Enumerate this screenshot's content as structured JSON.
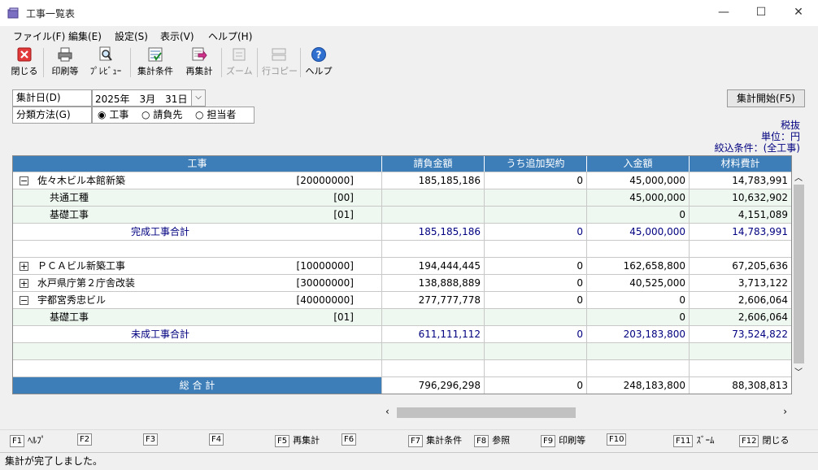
{
  "window": {
    "title": "工事一覧表",
    "minimize": "—",
    "maximize": "☐",
    "close": "✕"
  },
  "menu": [
    "ファイル(F)",
    "編集(E)",
    "設定(S)",
    "表示(V)",
    "ヘルプ(H)"
  ],
  "toolbar": [
    {
      "label": "閉じる",
      "icon": "close-icon"
    },
    {
      "label": "印刷等",
      "icon": "printer-icon"
    },
    {
      "label": "ﾌﾟﾚﾋﾞｭｰ",
      "icon": "preview-icon"
    },
    {
      "label": "集計条件",
      "icon": "conditions-icon"
    },
    {
      "label": "再集計",
      "icon": "recalc-icon"
    },
    {
      "label": "ズーム",
      "icon": "zoom-icon",
      "disabled": true
    },
    {
      "label": "行コピー",
      "icon": "row-copy-icon",
      "disabled": true
    },
    {
      "label": "ヘルプ",
      "icon": "help-icon"
    }
  ],
  "form": {
    "date_label": "集計日(D)",
    "date_value": "2025年　3月　31日",
    "class_label": "分類方法(G)",
    "options": [
      "工事",
      "請負先",
      "担当者"
    ],
    "selected": 0,
    "start_button": "集計開始(F5)"
  },
  "info": {
    "tax": "税抜",
    "unit": "単位：円",
    "filter": "絞込条件：(全工事)"
  },
  "columns": [
    "工事",
    "請負金額",
    "うち追加契約",
    "入金額",
    "材料費計"
  ],
  "rows": [
    {
      "expander": "−",
      "indent": 0,
      "name": "佐々木ビル本館新築",
      "code": "[20000000]",
      "amount": "185,185,186",
      "addition": "0",
      "received": "45,000,000",
      "material": "14,783,991"
    },
    {
      "indent": 1,
      "green": true,
      "name": "共通工種",
      "code": "[00]",
      "amount": "",
      "addition": "",
      "received": "45,000,000",
      "material": "10,632,902"
    },
    {
      "indent": 1,
      "green": true,
      "name": "基礎工事",
      "code": "[01]",
      "amount": "",
      "addition": "",
      "received": "0",
      "material": "4,151,089"
    },
    {
      "indent": 2,
      "total": true,
      "name": "完成工事合計",
      "code": "",
      "amount": "185,185,186",
      "addition": "0",
      "received": "45,000,000",
      "material": "14,783,991"
    },
    {
      "blank": true
    },
    {
      "expander": "+",
      "indent": 0,
      "name": "ＰＣＡビル新築工事",
      "code": "[10000000]",
      "amount": "194,444,445",
      "addition": "0",
      "received": "162,658,800",
      "material": "67,205,636"
    },
    {
      "expander": "+",
      "indent": 0,
      "name": "水戸県庁第２庁舎改装",
      "code": "[30000000]",
      "amount": "138,888,889",
      "addition": "0",
      "received": "40,525,000",
      "material": "3,713,122"
    },
    {
      "expander": "−",
      "indent": 0,
      "name": "宇都宮秀忠ビル",
      "code": "[40000000]",
      "amount": "277,777,778",
      "addition": "0",
      "received": "0",
      "material": "2,606,064"
    },
    {
      "indent": 1,
      "green": true,
      "name": "基礎工事",
      "code": "[01]",
      "amount": "",
      "addition": "",
      "received": "0",
      "material": "2,606,064"
    },
    {
      "indent": 2,
      "total": true,
      "name": "未成工事合計",
      "code": "",
      "amount": "611,111,112",
      "addition": "0",
      "received": "203,183,800",
      "material": "73,524,822"
    },
    {
      "blank": true,
      "green": true
    },
    {
      "blank": true
    }
  ],
  "grand_total": {
    "label": "総 合 計",
    "amount": "796,296,298",
    "addition": "0",
    "received": "248,183,800",
    "material": "88,308,813"
  },
  "fkeys": [
    {
      "key": "F1",
      "label": "ﾍﾙﾌﾟ"
    },
    {
      "key": "F2",
      "label": ""
    },
    {
      "key": "F3",
      "label": ""
    },
    {
      "key": "F4",
      "label": ""
    },
    {
      "key": "F5",
      "label": "再集計"
    },
    {
      "key": "F6",
      "label": ""
    },
    {
      "key": "F7",
      "label": "集計条件"
    },
    {
      "key": "F8",
      "label": "参照"
    },
    {
      "key": "F9",
      "label": "印刷等"
    },
    {
      "key": "F10",
      "label": ""
    },
    {
      "key": "F11",
      "label": "ｽﾞｰﾑ"
    },
    {
      "key": "F12",
      "label": "閉じる"
    }
  ],
  "status": "集計が完了しました。"
}
